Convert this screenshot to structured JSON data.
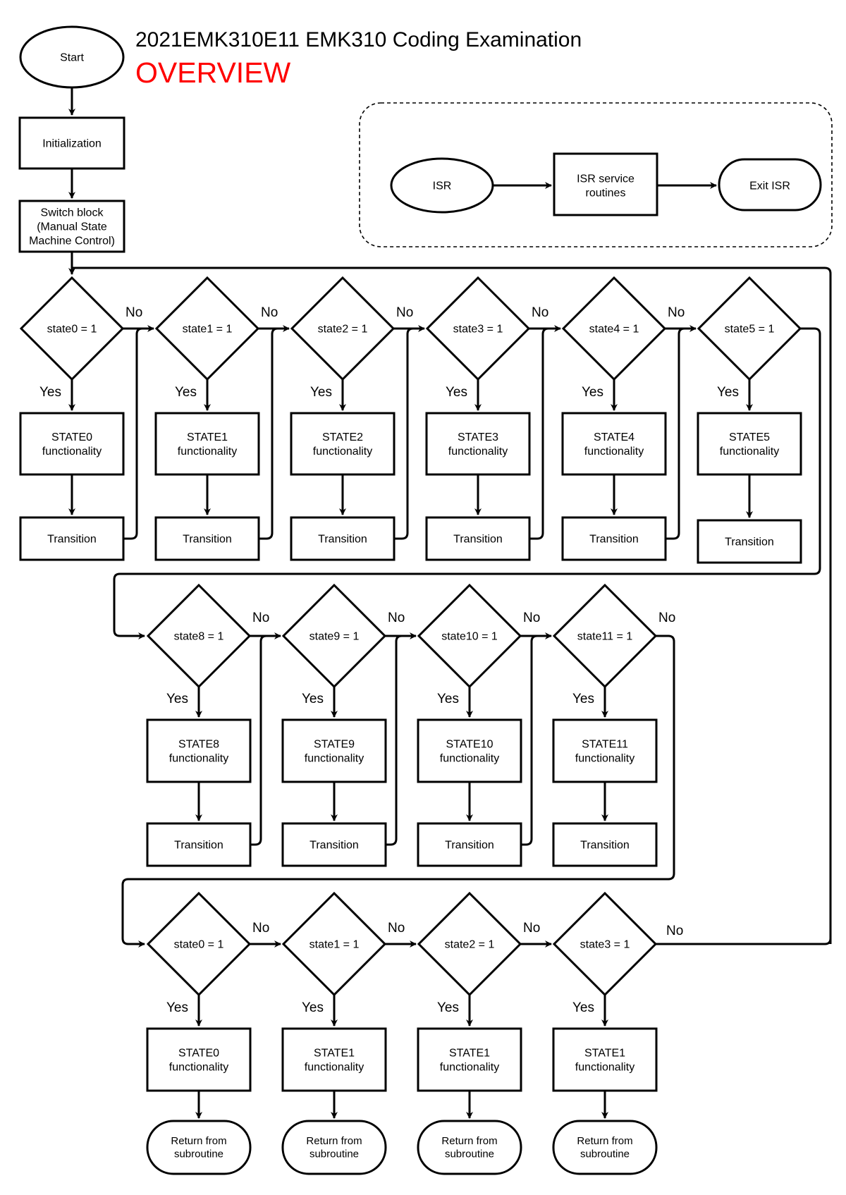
{
  "header": {
    "title": "2021EMK310E11 EMK310 Coding Examination",
    "subtitle": "OVERVIEW",
    "subtitle_color": "#ff0000"
  },
  "main_flow": {
    "start": "Start",
    "init": "Initialization",
    "switch_block": [
      "Switch block",
      "(Manual State",
      "Machine Control)"
    ]
  },
  "isr_group": {
    "isr": "ISR",
    "service": [
      "ISR service",
      "routines"
    ],
    "exit": "Exit ISR"
  },
  "labels": {
    "yes": "Yes",
    "no": "No",
    "transition": "Transition",
    "functionality": "functionality",
    "return": [
      "Return from",
      "subroutine"
    ]
  },
  "row1": [
    {
      "cond": "state0 = 1",
      "state": "STATE0"
    },
    {
      "cond": "state1 = 1",
      "state": "STATE1"
    },
    {
      "cond": "state2 = 1",
      "state": "STATE2"
    },
    {
      "cond": "state3 = 1",
      "state": "STATE3"
    },
    {
      "cond": "state4 = 1",
      "state": "STATE4"
    },
    {
      "cond": "state5 = 1",
      "state": "STATE5"
    }
  ],
  "row2": [
    {
      "cond": "state8 = 1",
      "state": "STATE8"
    },
    {
      "cond": "state9 = 1",
      "state": "STATE9"
    },
    {
      "cond": "state10 = 1",
      "state": "STATE10"
    },
    {
      "cond": "state11 = 1",
      "state": "STATE11"
    }
  ],
  "row3": [
    {
      "cond": "state0 = 1",
      "state": "STATE0"
    },
    {
      "cond": "state1 = 1",
      "state": "STATE1"
    },
    {
      "cond": "state2 = 1",
      "state": "STATE1"
    },
    {
      "cond": "state3 = 1",
      "state": "STATE1"
    }
  ]
}
